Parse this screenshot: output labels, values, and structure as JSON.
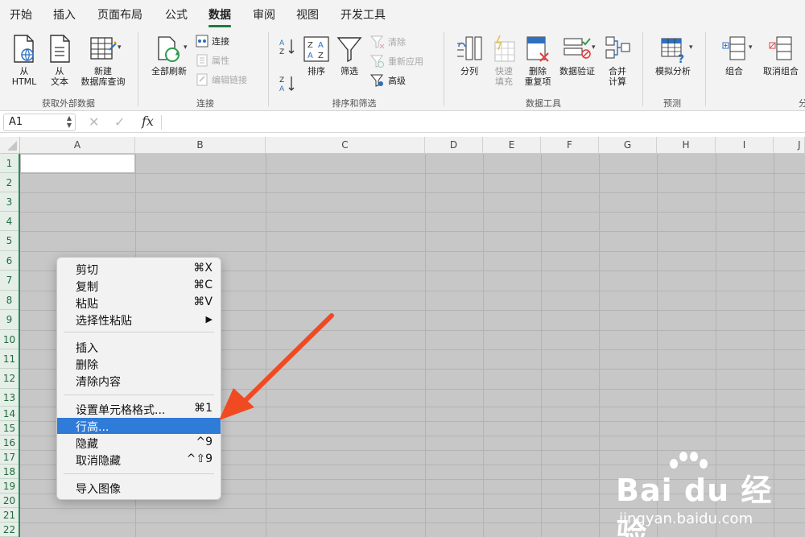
{
  "ribbon_tabs": [
    "开始",
    "插入",
    "页面布局",
    "公式",
    "数据",
    "审阅",
    "视图",
    "开发工具"
  ],
  "active_tab": "数据",
  "groups": {
    "external": {
      "label": "获取外部数据",
      "from_html": "从\nHTML",
      "from_text": "从\n文本",
      "new_query": "新建\n数据库查询"
    },
    "connections": {
      "label": "连接",
      "refresh_all": "全部刷新",
      "connections": "连接",
      "properties": "属性",
      "edit_links": "编辑链接"
    },
    "sort_filter": {
      "label": "排序和筛选",
      "sort": "排序",
      "filter": "筛选",
      "clear": "清除",
      "reapply": "重新应用",
      "advanced": "高级"
    },
    "data_tools": {
      "label": "数据工具",
      "text_to_columns": "分列",
      "flash_fill": "快速\n填充",
      "remove_dup": "删除\n重复项",
      "validation": "数据验证",
      "consolidate": "合并\n计算"
    },
    "forecast": {
      "label": "预测",
      "what_if": "模拟分析"
    },
    "outline": {
      "label": "分",
      "group": "组合",
      "ungroup": "取消组合"
    }
  },
  "formula_bar": {
    "name_box": "A1",
    "fx": "fx",
    "cancel": "✕",
    "confirm": "✓"
  },
  "columns": [
    "A",
    "B",
    "C",
    "D",
    "E",
    "F",
    "G",
    "H",
    "I",
    "J"
  ],
  "rows": [
    "1",
    "2",
    "3",
    "4",
    "5",
    "6",
    "7",
    "8",
    "9",
    "10",
    "11",
    "12",
    "13",
    "14",
    "15",
    "16",
    "17",
    "18",
    "19",
    "20",
    "21",
    "22"
  ],
  "context_menu": {
    "items": [
      {
        "label": "剪切",
        "shortcut": "⌘X"
      },
      {
        "label": "复制",
        "shortcut": "⌘C"
      },
      {
        "label": "粘贴",
        "shortcut": "⌘V"
      },
      {
        "label": "选择性粘贴",
        "shortcut": "▶"
      },
      {
        "label": "插入",
        "shortcut": ""
      },
      {
        "label": "删除",
        "shortcut": ""
      },
      {
        "label": "清除内容",
        "shortcut": ""
      },
      {
        "label": "设置单元格格式...",
        "shortcut": "⌘1"
      },
      {
        "label": "行高...",
        "shortcut": ""
      },
      {
        "label": "隐藏",
        "shortcut": "^9"
      },
      {
        "label": "取消隐藏",
        "shortcut": "^⇧9"
      },
      {
        "label": "导入图像",
        "shortcut": ""
      }
    ],
    "highlighted": "行高..."
  },
  "watermark": {
    "logo": "Bai du 经验",
    "url": "jingyan.baidu.com"
  },
  "colors": {
    "accent": "#1f7a43",
    "highlight": "#2f7bd8",
    "arrow": "#f04a23"
  }
}
